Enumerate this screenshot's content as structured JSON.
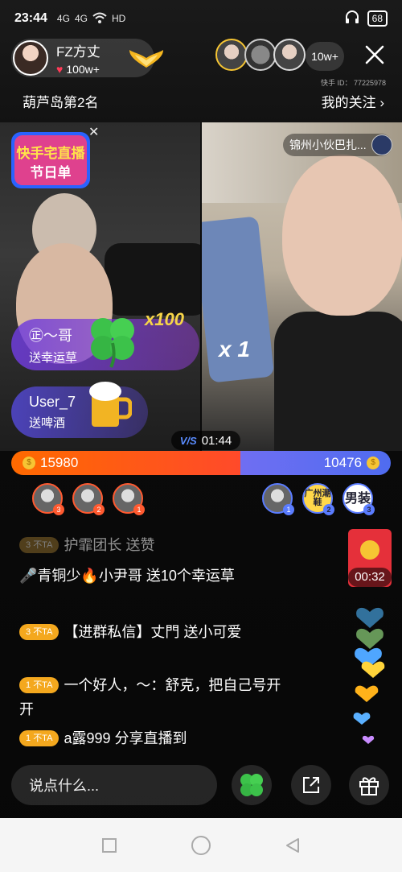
{
  "status_bar": {
    "time": "23:44",
    "signal1": "4G",
    "signal2": "4G",
    "network": "HD",
    "battery": "68"
  },
  "host": {
    "name": "FZ方丈",
    "likes": "100w+"
  },
  "viewers": {
    "count": "10w+"
  },
  "kuaishou_id": "快手 ID： 77225978",
  "rank_label": "葫芦岛第2名",
  "follow_label": "我的关注",
  "event_badge": {
    "line1": "快手宅直播",
    "line2": "节日单"
  },
  "remote_host": {
    "name": "锦州小伙巴扎..."
  },
  "gifts": [
    {
      "user": "㊣～哥",
      "action": "送幸运草",
      "multiplier": "x100"
    },
    {
      "user": "User_7",
      "action": "送啤酒",
      "multiplier": "x 1"
    }
  ],
  "pk": {
    "timer": "01:44",
    "left_score": "15980",
    "right_score": "10476",
    "left_share": 0.604
  },
  "rankers_left": [
    {
      "rank": "3"
    },
    {
      "rank": "2"
    },
    {
      "rank": "1"
    }
  ],
  "rankers_right": [
    {
      "rank": "1",
      "text": ""
    },
    {
      "rank": "2",
      "text": "广州潮鞋"
    },
    {
      "rank": "3",
      "text": "男装"
    }
  ],
  "chat": [
    {
      "level": "3",
      "badge": "不TA",
      "text": "护霏团长 送赞"
    },
    {
      "level": "",
      "badge": "",
      "text": "青铜少🔥小尹哥 送10个幸运草"
    },
    {
      "level": "3",
      "badge": "不TA",
      "text": "【进群私信】丈門 送小可爱"
    },
    {
      "level": "1",
      "badge": "不TA",
      "text": "一个好人，～：舒克，把自己号开开"
    },
    {
      "level": "1",
      "badge": "不TA",
      "text": "a露999 分享直播到"
    }
  ],
  "redpack": {
    "countdown": "00:32"
  },
  "input": {
    "placeholder": "说点什么..."
  },
  "colors": {
    "pk_left": "#ff5a1e",
    "pk_right": "#5a6cf0",
    "badge_orange": "#f4a81e",
    "heart": "#ff3b58"
  }
}
